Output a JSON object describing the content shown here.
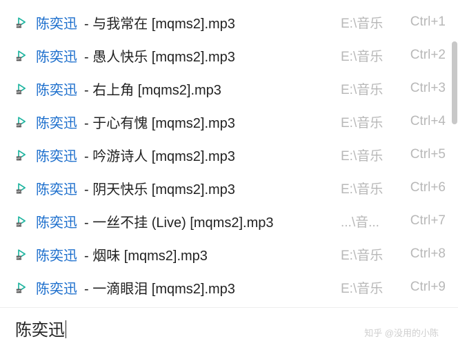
{
  "rows": [
    {
      "artist": "陈奕迅",
      "title": " - 与我常在 [mqms2].mp3",
      "path": "E:\\音乐",
      "shortcut": "Ctrl+1"
    },
    {
      "artist": "陈奕迅",
      "title": " - 愚人快乐 [mqms2].mp3",
      "path": "E:\\音乐",
      "shortcut": "Ctrl+2"
    },
    {
      "artist": "陈奕迅",
      "title": " - 右上角 [mqms2].mp3",
      "path": "E:\\音乐",
      "shortcut": "Ctrl+3"
    },
    {
      "artist": "陈奕迅",
      "title": " - 于心有愧 [mqms2].mp3",
      "path": "E:\\音乐",
      "shortcut": "Ctrl+4"
    },
    {
      "artist": "陈奕迅",
      "title": " - 吟游诗人 [mqms2].mp3",
      "path": "E:\\音乐",
      "shortcut": "Ctrl+5"
    },
    {
      "artist": "陈奕迅",
      "title": " - 阴天快乐 [mqms2].mp3",
      "path": "E:\\音乐",
      "shortcut": "Ctrl+6"
    },
    {
      "artist": "陈奕迅",
      "title": " - 一丝不挂 (Live) [mqms2].mp3",
      "path": "...\\音...",
      "shortcut": "Ctrl+7"
    },
    {
      "artist": "陈奕迅",
      "title": " - 烟味 [mqms2].mp3",
      "path": "E:\\音乐",
      "shortcut": "Ctrl+8"
    },
    {
      "artist": "陈奕迅",
      "title": " - 一滴眼泪 [mqms2].mp3",
      "path": "E:\\音乐",
      "shortcut": "Ctrl+9"
    }
  ],
  "search": {
    "value": "陈奕迅"
  },
  "watermark": "知乎 @没用的小陈"
}
